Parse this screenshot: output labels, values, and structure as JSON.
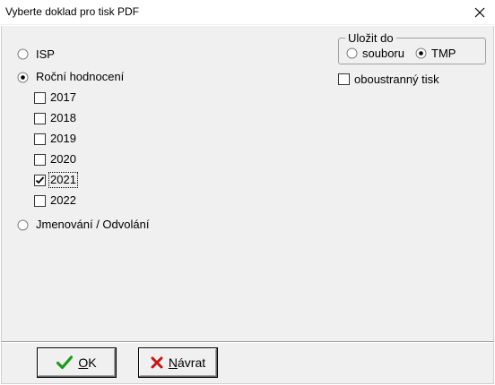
{
  "window": {
    "title": "Vyberte doklad pro tisk PDF"
  },
  "doc_type": {
    "options": [
      {
        "label": "ISP",
        "selected": false
      },
      {
        "label": "Roční hodnocení",
        "selected": true
      },
      {
        "label": "Jmenování / Odvolání",
        "selected": false
      }
    ],
    "years": [
      {
        "label": "2017",
        "checked": false
      },
      {
        "label": "2018",
        "checked": false
      },
      {
        "label": "2019",
        "checked": false
      },
      {
        "label": "2020",
        "checked": false
      },
      {
        "label": "2021",
        "checked": true
      },
      {
        "label": "2022",
        "checked": false
      }
    ]
  },
  "save_to": {
    "title": "Uložit do",
    "options": [
      {
        "label": "souboru",
        "selected": false
      },
      {
        "label": "TMP",
        "selected": true
      }
    ]
  },
  "duplex": {
    "label": "oboustranný tisk",
    "checked": false
  },
  "buttons": {
    "ok": {
      "label_accel": "O",
      "label_rest": "K"
    },
    "back": {
      "label_accel": "N",
      "label_rest": "ávrat"
    }
  },
  "colors": {
    "ok_icon": "#1a9b1a",
    "back_icon": "#c81414"
  }
}
